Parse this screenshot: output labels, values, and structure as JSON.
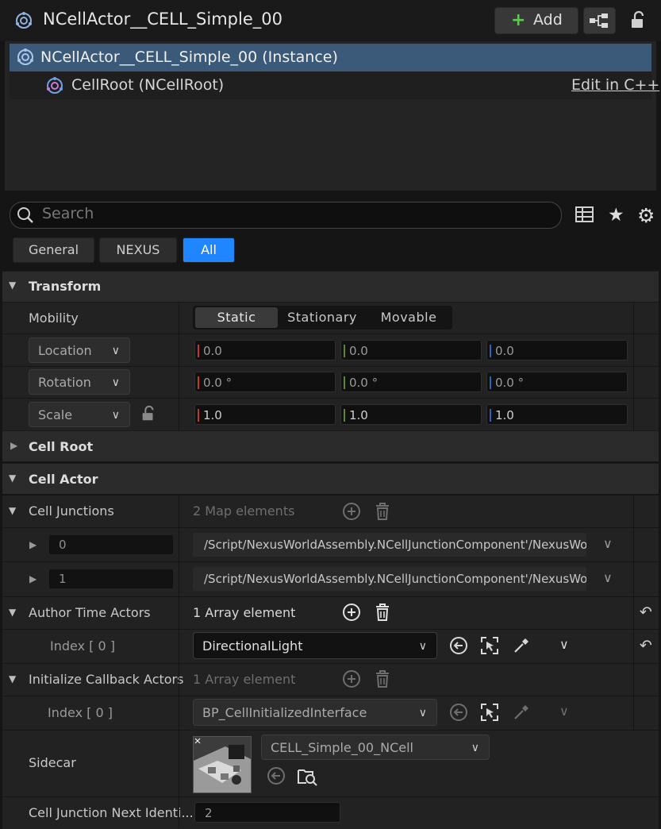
{
  "title": "NCellActor__CELL_Simple_00",
  "toolbar": {
    "add_label": "Add"
  },
  "components": {
    "instance_label": "NCellActor__CELL_Simple_00 (Instance)",
    "root_label": "CellRoot (NCellRoot)",
    "edit_link": "Edit in C++"
  },
  "search": {
    "placeholder": "Search"
  },
  "filters": [
    "General",
    "NEXUS",
    "All"
  ],
  "transform": {
    "header": "Transform",
    "mobility_label": "Mobility",
    "mobility_options": [
      "Static",
      "Stationary",
      "Movable"
    ],
    "mobility_selected": "Static",
    "location_label": "Location",
    "rotation_label": "Rotation",
    "scale_label": "Scale",
    "location": [
      "0.0",
      "0.0",
      "0.0"
    ],
    "rotation": [
      "0.0 °",
      "0.0 °",
      "0.0 °"
    ],
    "scale": [
      "1.0",
      "1.0",
      "1.0"
    ]
  },
  "cell_root": {
    "header": "Cell Root"
  },
  "cell_actor": {
    "header": "Cell Actor",
    "junctions_label": "Cell Junctions",
    "junctions_count": "2 Map elements",
    "junctions": [
      {
        "key": "0",
        "value": "/Script/NexusWorldAssembly.NCellJunctionComponent'/NexusWo"
      },
      {
        "key": "1",
        "value": "/Script/NexusWorldAssembly.NCellJunctionComponent'/NexusWo"
      }
    ],
    "author_label": "Author Time Actors",
    "author_count": "1 Array element",
    "author_index": "Index [ 0 ]",
    "author_value": "DirectionalLight",
    "callback_label": "Initialize Callback Actors",
    "callback_count": "1 Array element",
    "callback_index": "Index [ 0 ]",
    "callback_value": "BP_CellInitializedInterface",
    "sidecar_label": "Sidecar",
    "sidecar_value": "CELL_Simple_00_NCell",
    "next_id_label": "Cell Junction Next Identi...",
    "next_id_value": "2"
  },
  "colors": {
    "accent": "#1f86ff",
    "selection": "#3b5a7a",
    "x_axis": "#c0392b",
    "y_axis": "#5c8a2a",
    "z_axis": "#2f63b8"
  },
  "icons": [
    "actor-icon",
    "add-plus-icon",
    "blueprint-icon",
    "lock-icon",
    "search-icon",
    "table-view-icon",
    "star-icon",
    "settings-icon",
    "reset-icon",
    "browse-icon",
    "select-actor-icon",
    "eyedropper-icon",
    "trash-icon",
    "add-element-icon"
  ]
}
